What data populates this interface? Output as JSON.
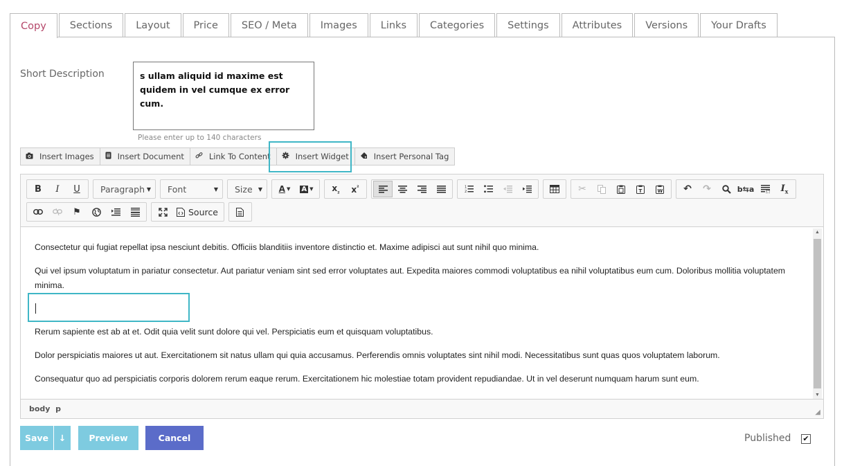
{
  "tabs": [
    {
      "label": "Copy"
    },
    {
      "label": "Sections"
    },
    {
      "label": "Layout"
    },
    {
      "label": "Price"
    },
    {
      "label": "SEO / Meta"
    },
    {
      "label": "Images"
    },
    {
      "label": "Links"
    },
    {
      "label": "Categories"
    },
    {
      "label": "Settings"
    },
    {
      "label": "Attributes"
    },
    {
      "label": "Versions"
    },
    {
      "label": "Your Drafts"
    }
  ],
  "short_description": {
    "label": "Short Description",
    "value": "s ullam aliquid id maxime est quidem in vel cumque ex error cum.",
    "hint": "Please enter up to 140 characters"
  },
  "insert_toolbar": [
    {
      "label": "Insert Images",
      "icon": "camera-icon"
    },
    {
      "label": "Insert Document",
      "icon": "document-icon"
    },
    {
      "label": "Link To Content",
      "icon": "link-icon"
    },
    {
      "label": "Insert Widget",
      "icon": "gear-icon"
    },
    {
      "label": "Insert Personal Tag",
      "icon": "tag-icon"
    }
  ],
  "editor": {
    "format_combo": "Paragraph",
    "font_combo": "Font",
    "size_combo": "Size",
    "source_label": "Source",
    "paragraphs": [
      "Consectetur qui fugiat repellat ipsa nesciunt debitis. Officiis blanditiis inventore distinctio et. Maxime adipisci aut sunt nihil quo minima.",
      "Qui vel ipsum voluptatum in pariatur consectetur. Aut pariatur veniam sint sed error voluptates aut. Expedita maiores commodi voluptatibus ea nihil voluptatibus eum cum. Doloribus mollitia voluptatem minima.",
      "Rerum sapiente est ab at et. Odit quia velit sunt dolore qui vel. Perspiciatis eum et quisquam voluptatibus.",
      "Dolor perspiciatis maiores ut aut. Exercitationem sit natus ullam qui quia accusamus. Perferendis omnis voluptates sint nihil modi. Necessitatibus sunt quas quos voluptatem laborum.",
      "Consequatur quo ad perspiciatis corporis dolorem rerum eaque rerum. Exercitationem hic molestiae totam provident repudiandae. Ut in vel deserunt numquam harum sunt eum."
    ],
    "element_path": "body  p"
  },
  "actions": {
    "save": "Save",
    "save_more": "↓",
    "preview": "Preview",
    "cancel": "Cancel",
    "published_label": "Published",
    "published_checked": true
  },
  "colors": {
    "active_tab": "#b5476a",
    "highlight": "#3fb6c6",
    "save_button": "#7ecbe0",
    "cancel_button": "#5b6cc9"
  }
}
